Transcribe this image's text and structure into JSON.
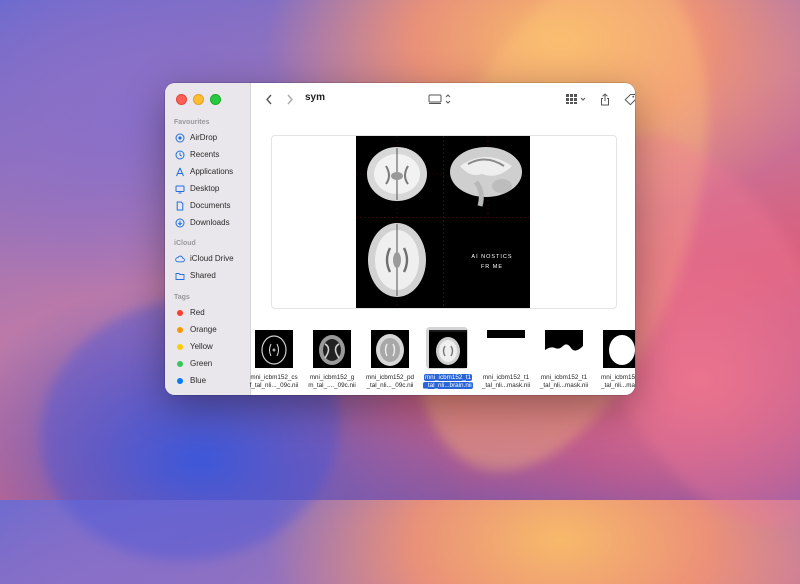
{
  "window": {
    "folder_title": "sym"
  },
  "sidebar": {
    "favourites_header": "Favourites",
    "favourites": [
      {
        "label": "AirDrop",
        "icon": "airdrop-icon"
      },
      {
        "label": "Recents",
        "icon": "clock-icon"
      },
      {
        "label": "Applications",
        "icon": "applications-icon"
      },
      {
        "label": "Desktop",
        "icon": "desktop-icon"
      },
      {
        "label": "Documents",
        "icon": "document-icon"
      },
      {
        "label": "Downloads",
        "icon": "download-icon"
      }
    ],
    "icloud_header": "iCloud",
    "icloud": [
      {
        "label": "iCloud Drive",
        "icon": "cloud-icon"
      },
      {
        "label": "Shared",
        "icon": "shared-folder-icon"
      }
    ],
    "tags_header": "Tags",
    "tags": [
      {
        "label": "Red",
        "color": "#ff3b30"
      },
      {
        "label": "Orange",
        "color": "#ff9500"
      },
      {
        "label": "Yellow",
        "color": "#ffcc00"
      },
      {
        "label": "Green",
        "color": "#34c759"
      },
      {
        "label": "Blue",
        "color": "#007aff"
      }
    ]
  },
  "preview": {
    "logo_line1": "AI NOSTICS",
    "logo_line2": "FR  ME"
  },
  "files": [
    {
      "line1": "mni_icbm152_cs",
      "line2": "f_tal_nli..._09c.nii",
      "selected": false
    },
    {
      "line1": "mni_icbm152_g",
      "line2": "m_tal_...._09c.nii",
      "selected": false
    },
    {
      "line1": "mni_icbm152_pd",
      "line2": "_tal_nli..._09c.nii",
      "selected": false
    },
    {
      "line1": "mni_icbm152_t1",
      "line2": "_tal_nli...brain.nii",
      "selected": true
    },
    {
      "line1": "mni_icbm152_t1",
      "line2": "_tal_nli...mask.nii",
      "selected": false
    },
    {
      "line1": "mni_icbm152_t1",
      "line2": "_tal_nli...mask.nii",
      "selected": false
    },
    {
      "line1": "mni_icbm15",
      "line2": "_tal_nli...ma",
      "selected": false
    }
  ],
  "colors": {
    "accent": "#2a65d8",
    "sidebar_bg": "#e9e7eb"
  }
}
